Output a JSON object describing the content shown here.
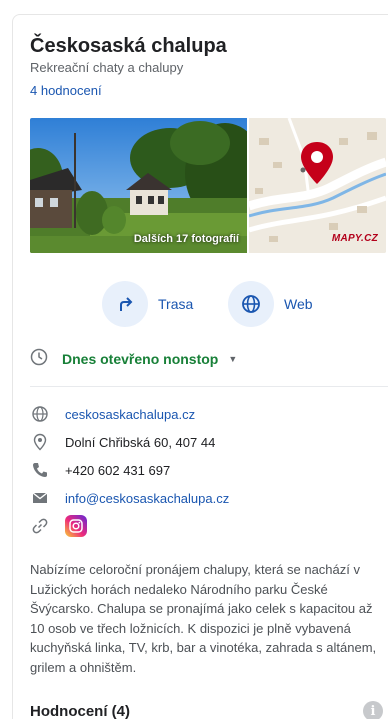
{
  "place": {
    "title": "Českosaská chalupa",
    "category": "Rekreační chaty a chalupy",
    "reviews_link": "4 hodnocení"
  },
  "media": {
    "photo_caption": "Dalších 17 fotografií",
    "map_brand": "MAPY.CZ"
  },
  "actions": [
    {
      "label": "Trasa",
      "icon": "directions-icon"
    },
    {
      "label": "Web",
      "icon": "globe-icon"
    }
  ],
  "hours": {
    "status": "Dnes otevřeno nonstop",
    "icon": "clock-icon"
  },
  "info": {
    "website": "ceskosaskachalupa.cz",
    "address": "Dolní Chřibská 60, 407 44",
    "phone": "+420 602 431 697",
    "email": "info@ceskosaskachalupa.cz"
  },
  "description": "Nabízíme celoroční pronájem chalupy, která se nachází v Lužických horách nedaleko Národního parku České Švýcarsko. Chalupa se pronajímá jako celek s kapacitou až 10 osob ve třech ložnicích. K dispozici je plně vybavená kuchyňská linka, TV, krb, bar a vinotéka, zahrada s altánem, grilem a ohništěm.",
  "reviews_section": {
    "title": "Hodnocení  (4)"
  },
  "colors": {
    "link": "#1a56b0",
    "open_status": "#188038",
    "action_bg": "#e8f0fb",
    "map_pin": "#c5001a"
  }
}
